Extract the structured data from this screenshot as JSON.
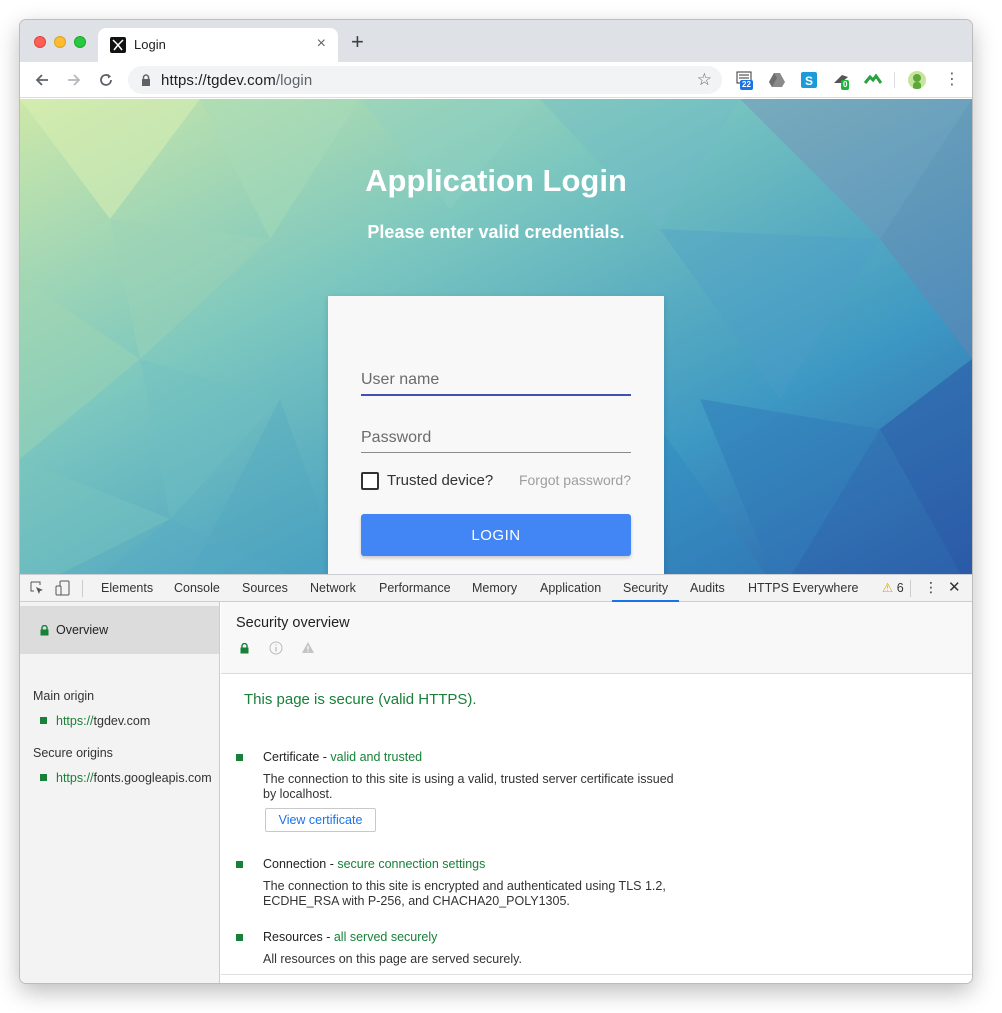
{
  "browser": {
    "tab_title": "Login",
    "tab_close": "×",
    "new_tab": "+",
    "url_host": "https://tgdev.com",
    "url_path": "/login",
    "star": "☆",
    "ext_badges": [
      "22",
      "0"
    ],
    "menu": "⋮"
  },
  "page": {
    "title": "Application Login",
    "subtitle": "Please enter valid credentials.",
    "username_placeholder": "User name",
    "password_placeholder": "Password",
    "trusted_label": "Trusted device?",
    "forgot_label": "Forgot password?",
    "login_label": "LOGIN"
  },
  "devtools": {
    "tabs": [
      "Elements",
      "Console",
      "Sources",
      "Network",
      "Performance",
      "Memory",
      "Application",
      "Security",
      "Audits",
      "HTTPS Everywhere"
    ],
    "active_tab": "Security",
    "warning_count": "6",
    "kebab": "⋮",
    "close": "✕",
    "sidebar": {
      "overview": "Overview",
      "main_origin_heading": "Main origin",
      "main_origin": {
        "scheme": "https://",
        "host": "tgdev.com"
      },
      "secure_origins_heading": "Secure origins",
      "secure_origin": {
        "scheme": "https://",
        "host": "fonts.googleapis.com"
      }
    },
    "overview": {
      "title": "Security overview",
      "summary": "This page is secure (valid HTTPS).",
      "items": [
        {
          "label": "Certificate",
          "sep": " - ",
          "link": "valid and trusted",
          "desc": "The connection to this site is using a valid, trusted server certificate issued by localhost.",
          "button": "View certificate"
        },
        {
          "label": "Connection",
          "sep": " - ",
          "link": "secure connection settings",
          "desc": "The connection to this site is encrypted and authenticated using TLS 1.2, ECDHE_RSA with P-256, and CHACHA20_POLY1305."
        },
        {
          "label": "Resources",
          "sep": " - ",
          "link": "all served securely",
          "desc": "All resources on this page are served securely."
        }
      ]
    }
  },
  "colors": {
    "secure_green": "#188038",
    "login_button": "#4285f4",
    "active_tab_underline": "#1a73e8"
  },
  "icons": [
    "back-arrow-icon",
    "forward-arrow-icon",
    "reload-icon",
    "lock-icon",
    "star-icon",
    "extension-icons",
    "inspect-icon",
    "device-toggle-icon",
    "info-icon",
    "warning-icon"
  ]
}
